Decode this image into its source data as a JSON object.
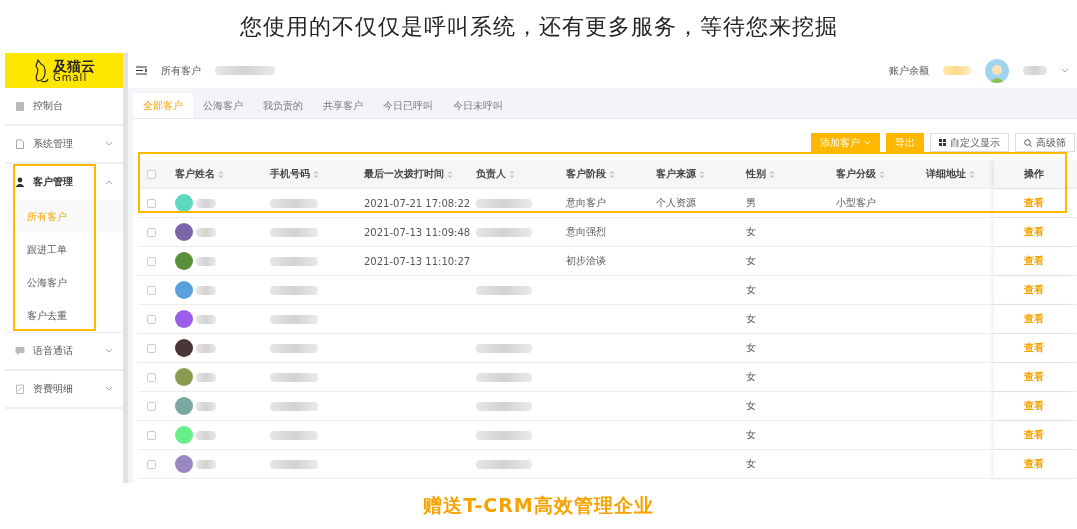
{
  "headline": "您使用的不仅仅是呼叫系统，还有更多服务，等待您来挖掘",
  "logo": {
    "name": "及猫云",
    "latin": "Gmall"
  },
  "sidebar": {
    "items": [
      {
        "label": "控制台"
      },
      {
        "label": "系统管理",
        "expanded": false
      },
      {
        "label": "客户管理",
        "expanded": true,
        "highlighted": true,
        "children": [
          {
            "label": "所有客户",
            "selected": true
          },
          {
            "label": "跟进工单",
            "selected": false
          },
          {
            "label": "公海客户",
            "selected": false
          },
          {
            "label": "客户去重",
            "selected": false
          }
        ]
      },
      {
        "label": "语音通话",
        "expanded": false
      },
      {
        "label": "资费明细",
        "expanded": false
      }
    ]
  },
  "topbar": {
    "breadcrumb": "所有客户",
    "balance_label": "账户余额"
  },
  "tabs": [
    {
      "label": "全部客户",
      "selected": true
    },
    {
      "label": "公海客户",
      "selected": false
    },
    {
      "label": "我负责的",
      "selected": false
    },
    {
      "label": "共享客户",
      "selected": false
    },
    {
      "label": "今日已呼叫",
      "selected": false
    },
    {
      "label": "今日未呼叫",
      "selected": false
    }
  ],
  "toolbar": [
    {
      "label": "添加客户",
      "kind": "primary-menu"
    },
    {
      "label": "导出",
      "kind": "primary"
    },
    {
      "label": "自定义显示",
      "kind": "grid"
    },
    {
      "label": "高级筛",
      "kind": "search"
    }
  ],
  "table": {
    "highlight_first_row": true,
    "header_checked": false,
    "columns": [
      "客户姓名",
      "手机号码",
      "最后一次拨打时间",
      "负责人",
      "客户阶段",
      "客户来源",
      "性别",
      "客户分级",
      "详细地址",
      "操作"
    ],
    "rows": [
      {
        "checked": false,
        "color": "#5fd8c0",
        "owner_blurred": true,
        "time": "2021-07-21 17:08:22",
        "stage": "意向客户",
        "source": "个人资源",
        "gender": "男",
        "grade": "小型客户",
        "action": "查看"
      },
      {
        "checked": false,
        "color": "#7a65a8",
        "owner_blurred": true,
        "time": "2021-07-13 11:09:48",
        "stage": "意向强烈",
        "gender": "女",
        "action": "查看"
      },
      {
        "checked": false,
        "color": "#5a8f3a",
        "time": "2021-07-13 11:10:27",
        "stage": "初步洽谈",
        "gender": "女",
        "action": "查看"
      },
      {
        "checked": false,
        "color": "#5aa0dc",
        "owner_blurred": true,
        "gender": "女",
        "action": "查看"
      },
      {
        "checked": false,
        "color": "#9a5ee8",
        "gender": "女",
        "action": "查看"
      },
      {
        "checked": false,
        "color": "#4a3636",
        "owner_blurred": true,
        "gender": "女",
        "action": "查看"
      },
      {
        "checked": false,
        "color": "#8a9a50",
        "owner_blurred": true,
        "gender": "女",
        "action": "查看"
      },
      {
        "checked": false,
        "color": "#7aa8a0",
        "owner_blurred": true,
        "gender": "女",
        "action": "查看"
      },
      {
        "checked": false,
        "color": "#66ee88",
        "owner_blurred": true,
        "gender": "女",
        "action": "查看"
      },
      {
        "checked": false,
        "color": "#9a88c0",
        "owner_blurred": true,
        "gender": "女",
        "action": "查看"
      }
    ]
  },
  "footer": "赠送T-CRM高效管理企业"
}
